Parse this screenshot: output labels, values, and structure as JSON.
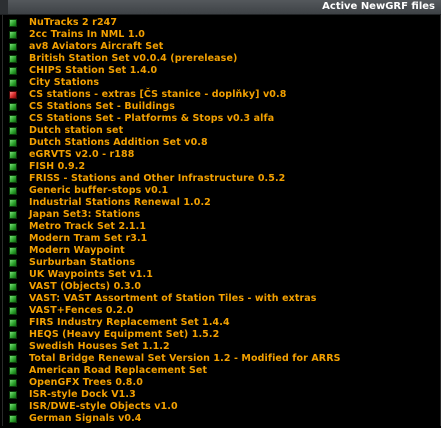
{
  "window": {
    "title": "Active NewGRF files"
  },
  "colors": {
    "text": "#f2a000",
    "ok_status": "#2fa52f",
    "error_status": "#d52a2a",
    "background": "#000000"
  },
  "newgrf_list": [
    {
      "label": "NuTracks 2 r247",
      "status": "ok"
    },
    {
      "label": "2cc Trains In NML 1.0",
      "status": "ok"
    },
    {
      "label": "av8 Aviators Aircraft Set",
      "status": "ok"
    },
    {
      "label": "British Station Set v0.0.4 (prerelease)",
      "status": "ok"
    },
    {
      "label": "CHIPS Station Set 1.4.0",
      "status": "ok"
    },
    {
      "label": "City Stations",
      "status": "ok"
    },
    {
      "label": "CS stations - extras [ČS stanice - doplňky] v0.8",
      "status": "error"
    },
    {
      "label": "CS Stations Set - Buildings",
      "status": "ok"
    },
    {
      "label": "CS Stations Set - Platforms & Stops v0.3 alfa",
      "status": "ok"
    },
    {
      "label": "Dutch station set",
      "status": "ok"
    },
    {
      "label": "Dutch Stations Addition Set v0.8",
      "status": "ok"
    },
    {
      "label": "eGRVTS v2.0 - r188",
      "status": "ok"
    },
    {
      "label": "FISH 0.9.2",
      "status": "ok"
    },
    {
      "label": "FRISS - Stations and Other Infrastructure 0.5.2",
      "status": "ok"
    },
    {
      "label": "Generic buffer-stops v0.1",
      "status": "ok"
    },
    {
      "label": "Industrial Stations Renewal 1.0.2",
      "status": "ok"
    },
    {
      "label": "Japan Set3: Stations",
      "status": "ok"
    },
    {
      "label": "Metro Track Set 2.1.1",
      "status": "ok"
    },
    {
      "label": "Modern Tram Set r3.1",
      "status": "ok"
    },
    {
      "label": "Modern Waypoint",
      "status": "ok"
    },
    {
      "label": "Surburban Stations",
      "status": "ok"
    },
    {
      "label": "UK Waypoints Set v1.1",
      "status": "ok"
    },
    {
      "label": "VAST (Objects) 0.3.0",
      "status": "ok"
    },
    {
      "label": "VAST: VAST Assortment of Station Tiles - with extras",
      "status": "ok"
    },
    {
      "label": "VAST+Fences 0.2.0",
      "status": "ok"
    },
    {
      "label": "FIRS Industry Replacement Set 1.4.4",
      "status": "ok"
    },
    {
      "label": "HEQS (Heavy Equipment Set) 1.5.2",
      "status": "ok"
    },
    {
      "label": "Swedish Houses Set 1.1.2",
      "status": "ok"
    },
    {
      "label": "Total Bridge Renewal Set Version 1.2 - Modified for ARRS",
      "status": "ok"
    },
    {
      "label": "American Road Replacement Set",
      "status": "ok"
    },
    {
      "label": "OpenGFX Trees 0.8.0",
      "status": "ok"
    },
    {
      "label": "ISR-style Dock V1.3",
      "status": "ok"
    },
    {
      "label": "ISR/DWE-style Objects v1.0",
      "status": "ok"
    },
    {
      "label": "German Signals v0.4",
      "status": "ok"
    }
  ]
}
